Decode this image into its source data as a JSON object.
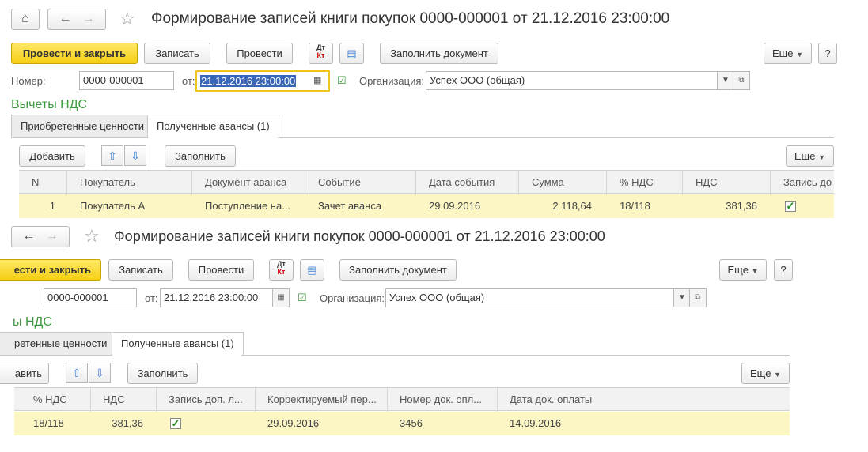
{
  "window": {
    "title": "Формирование записей книги покупок 0000-000001 от 21.12.2016 23:00:00"
  },
  "toolbar": {
    "post_close": "Провести и закрыть",
    "post_close_cropped": "ести и закрыть",
    "save": "Записать",
    "post": "Провести",
    "dtkt_icon_text": "Дт Кт",
    "fill_document": "Заполнить документ",
    "more": "Еще",
    "help": "?"
  },
  "header": {
    "number_label": "Номер:",
    "number_value": "0000-000001",
    "date_label": "от:",
    "date_value": "21.12.2016 23:00:00",
    "org_label": "Организация:",
    "org_value": "Успех ООО (общая)"
  },
  "section": {
    "title": "Вычеты НДС",
    "title_cropped": "ы НДС"
  },
  "tabs": {
    "acquired": "Приобретенные ценности",
    "acquired_cropped": "ретенные ценности",
    "advances": "Полученные авансы (1)"
  },
  "table_toolbar": {
    "add": "Добавить",
    "add_cropped": "авить",
    "fill": "Заполнить",
    "more": "Еще"
  },
  "table_top": {
    "columns": [
      "N",
      "Покупатель",
      "Документ аванса",
      "Событие",
      "Дата события",
      "Сумма",
      "% НДС",
      "НДС",
      "Запись до"
    ],
    "row": {
      "n": "1",
      "buyer": "Покупатель А",
      "advance_doc": "Поступление на...",
      "event": "Зачет аванса",
      "event_date": "29.09.2016",
      "amount": "2 118,64",
      "vat_rate": "18/118",
      "vat": "381,36",
      "record_checked": true
    }
  },
  "table_bottom": {
    "columns": [
      "% НДС",
      "НДС",
      "Запись доп. л...",
      "Корректируемый пер...",
      "Номер док. опл...",
      "Дата док. оплаты"
    ],
    "row": {
      "vat_rate": "18/118",
      "vat": "381,36",
      "record_checked": true,
      "corrected_period": "29.09.2016",
      "payment_doc_number": "3456",
      "payment_doc_date": "14.09.2016"
    }
  }
}
